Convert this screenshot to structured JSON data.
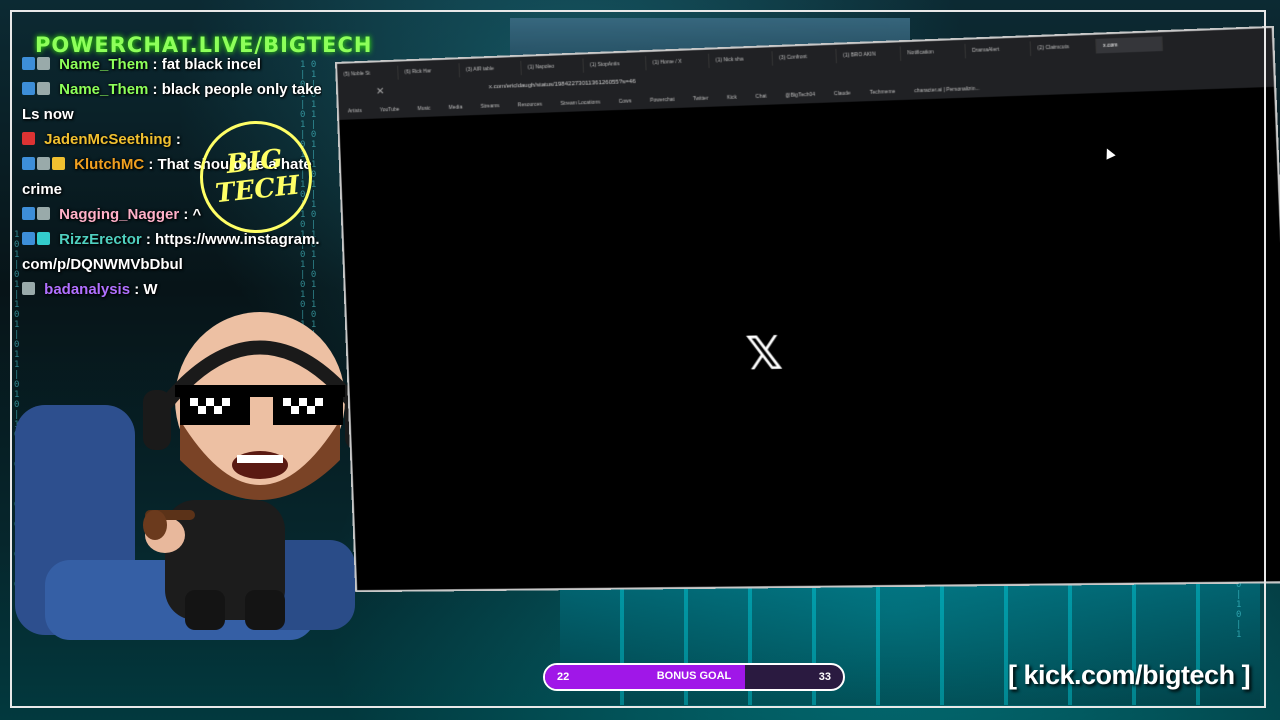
{
  "overlay": {
    "brand_title": "POWERCHAT.LIVE/BIGTECH",
    "logo_text": "BIG TECH",
    "kick_link": "[ kick.com/bigtech ]"
  },
  "chat": {
    "messages": [
      {
        "user": "Name_Them",
        "user_color": "#8dff5a",
        "text": ": fat black incel"
      },
      {
        "user": "Name_Them",
        "user_color": "#8dff5a",
        "text": ": black people only take Ls now"
      },
      {
        "user": "JadenMcSeething",
        "user_color": "#f0c030",
        "text": ":"
      },
      {
        "user": "KlutchMC",
        "user_color": "#f0a020",
        "text": ": That should be a hate crime"
      },
      {
        "user": "Nagging_Nagger",
        "user_color": "#ffb0c8",
        "text": ": ^"
      },
      {
        "user": "RizzErector",
        "user_color": "#4fd0c0",
        "text": ": https://www.instagram.com/p/DQNWMVbDbul"
      },
      {
        "user": "badanalysis",
        "user_color": "#b070ff",
        "text": ": W"
      }
    ]
  },
  "browser": {
    "tabs": [
      "(5) Noble St",
      "(6) Rick Har",
      "(3) AIR table",
      "(1) Napoleo",
      "(1) StopAntis",
      "(1) Home / X",
      "(1) Nick sha",
      "(3) Confront",
      "(1) BRO AKIN",
      "Notification",
      "DramaAlert",
      "(2) Claimcuts",
      "x.com"
    ],
    "url": "x.com/ericldaugh/status/1984227301136126055?s=46",
    "bookmarks": [
      "Artists",
      "YouTube",
      "Music",
      "Media",
      "Streams",
      "Resources",
      "Stream Locations",
      "Cows",
      "Powerchat",
      "Twitter",
      "Kick",
      "Chat",
      "@BigTech04",
      "Claude",
      "Techmeme",
      "character.ai | Personalizin..."
    ],
    "page_logo": "𝕏"
  },
  "goal": {
    "current": "22",
    "label": "BONUS GOAL",
    "target": "33",
    "progress": 0.67,
    "fill_color": "#a017e8"
  }
}
